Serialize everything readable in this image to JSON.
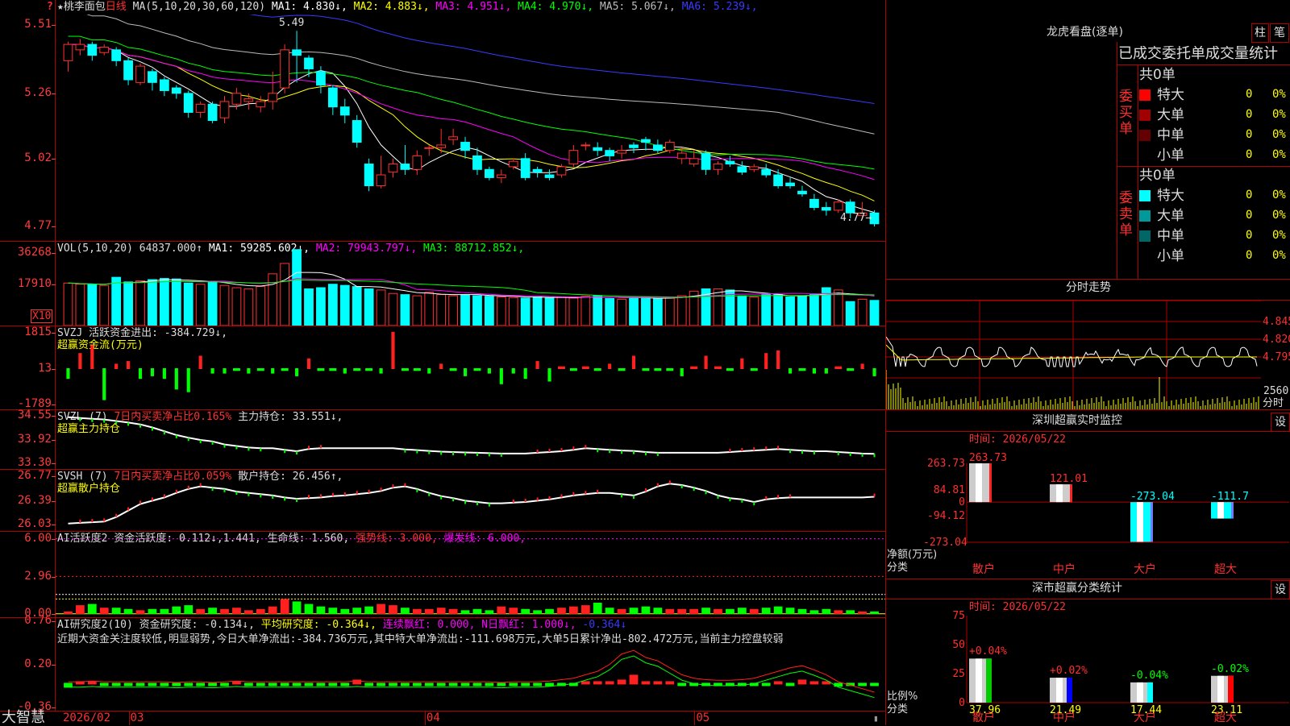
{
  "logo_mark": "?",
  "main": {
    "title": "★桃李面包",
    "period": "日线",
    "ma_params": "MA(5,10,20,30,60,120)",
    "ma": [
      {
        "label": "MA1:",
        "value": "4.830↓",
        "color": "#ffffff"
      },
      {
        "label": "MA2:",
        "value": "4.883↓",
        "color": "#ffff00"
      },
      {
        "label": "MA3:",
        "value": "4.951↓",
        "color": "#ff00ff"
      },
      {
        "label": "MA4:",
        "value": "4.970↓",
        "color": "#00ff00"
      },
      {
        "label": "MA5:",
        "value": "5.067↓",
        "color": "#bbbbbb"
      },
      {
        "label": "MA6:",
        "value": "5.239↓",
        "color": "#3a3aff"
      }
    ],
    "y_ticks": [
      "5.51",
      "5.26",
      "5.02",
      "4.77"
    ],
    "high_label": "5.49",
    "low_label": "4.77",
    "candles": [
      [
        5.38,
        5.44,
        5.34,
        5.45
      ],
      [
        5.42,
        5.44,
        5.4,
        5.46
      ],
      [
        5.44,
        5.4,
        5.38,
        5.45
      ],
      [
        5.41,
        5.43,
        5.4,
        5.44
      ],
      [
        5.42,
        5.38,
        5.36,
        5.43
      ],
      [
        5.38,
        5.31,
        5.29,
        5.39
      ],
      [
        5.3,
        5.36,
        5.29,
        5.37
      ],
      [
        5.34,
        5.3,
        5.27,
        5.35
      ],
      [
        5.31,
        5.27,
        5.25,
        5.32
      ],
      [
        5.28,
        5.26,
        5.24,
        5.29
      ],
      [
        5.26,
        5.19,
        5.17,
        5.27
      ],
      [
        5.19,
        5.22,
        5.17,
        5.23
      ],
      [
        5.22,
        5.16,
        5.15,
        5.23
      ],
      [
        5.17,
        5.23,
        5.15,
        5.25
      ],
      [
        5.22,
        5.26,
        5.2,
        5.28
      ],
      [
        5.23,
        5.24,
        5.2,
        5.26
      ],
      [
        5.21,
        5.23,
        5.19,
        5.25
      ],
      [
        5.23,
        5.26,
        5.2,
        5.34
      ],
      [
        5.28,
        5.42,
        5.26,
        5.44
      ],
      [
        5.42,
        5.4,
        5.3,
        5.49
      ],
      [
        5.39,
        5.35,
        5.32,
        5.4
      ],
      [
        5.34,
        5.29,
        5.26,
        5.36
      ],
      [
        5.28,
        5.21,
        5.18,
        5.29
      ],
      [
        5.21,
        5.18,
        5.15,
        5.24
      ],
      [
        5.16,
        5.08,
        5.06,
        5.18
      ],
      [
        5.0,
        4.92,
        4.9,
        5.02
      ],
      [
        4.92,
        4.96,
        4.91,
        5.03
      ],
      [
        4.97,
        5.0,
        4.95,
        5.02
      ],
      [
        5.0,
        4.98,
        4.96,
        5.07
      ],
      [
        4.98,
        5.03,
        4.96,
        5.05
      ],
      [
        5.06,
        5.06,
        5.03,
        5.07
      ],
      [
        5.06,
        5.07,
        5.04,
        5.13
      ],
      [
        5.09,
        5.1,
        5.07,
        5.13
      ],
      [
        5.08,
        5.05,
        5.02,
        5.1
      ],
      [
        5.03,
        4.98,
        4.96,
        5.06
      ],
      [
        4.98,
        4.95,
        4.94,
        4.99
      ],
      [
        4.95,
        4.96,
        4.93,
        4.98
      ],
      [
        4.99,
        5.01,
        4.98,
        5.02
      ],
      [
        5.02,
        4.95,
        4.94,
        5.04
      ],
      [
        4.98,
        4.97,
        4.95,
        4.99
      ],
      [
        4.96,
        4.95,
        4.94,
        4.98
      ],
      [
        4.96,
        4.99,
        4.95,
        5.0
      ],
      [
        5.0,
        5.05,
        4.99,
        5.07
      ],
      [
        5.07,
        5.07,
        5.05,
        5.08
      ],
      [
        5.06,
        5.05,
        5.03,
        5.08
      ],
      [
        5.05,
        5.03,
        5.01,
        5.06
      ],
      [
        5.04,
        5.05,
        5.02,
        5.07
      ],
      [
        5.07,
        5.06,
        5.04,
        5.08
      ],
      [
        5.09,
        5.08,
        5.05,
        5.1
      ],
      [
        5.07,
        5.05,
        5.04,
        5.09
      ],
      [
        5.05,
        5.08,
        5.04,
        5.09
      ],
      [
        5.02,
        5.04,
        5.0,
        5.06
      ],
      [
        5.0,
        5.02,
        4.99,
        5.05
      ],
      [
        5.04,
        4.98,
        4.96,
        5.05
      ],
      [
        4.98,
        5.0,
        4.96,
        5.01
      ],
      [
        5.01,
        5.0,
        4.99,
        5.03
      ],
      [
        4.99,
        4.97,
        4.96,
        5.01
      ],
      [
        4.98,
        4.99,
        4.97,
        5.0
      ],
      [
        4.98,
        4.96,
        4.95,
        5.0
      ],
      [
        4.96,
        4.92,
        4.91,
        4.98
      ],
      [
        4.93,
        4.92,
        4.91,
        4.95
      ],
      [
        4.9,
        4.89,
        4.88,
        4.92
      ],
      [
        4.87,
        4.84,
        4.83,
        4.89
      ],
      [
        4.84,
        4.83,
        4.81,
        4.86
      ],
      [
        4.83,
        4.86,
        4.82,
        4.87
      ],
      [
        4.86,
        4.82,
        4.8,
        4.87
      ],
      [
        4.81,
        4.82,
        4.8,
        4.86
      ],
      [
        4.82,
        4.78,
        4.77,
        4.83
      ]
    ]
  },
  "vol": {
    "title": "VOL(5,10,20)",
    "value": "64837.000↑",
    "ma": [
      {
        "label": "MA1:",
        "value": "59285.602↓",
        "color": "#ffffff"
      },
      {
        "label": "MA2:",
        "value": "79943.797↓",
        "color": "#ff00ff"
      },
      {
        "label": "MA3:",
        "value": "88712.852↓",
        "color": "#00ff00"
      }
    ],
    "y_ticks": [
      "36268",
      "17910"
    ],
    "unit": "X10",
    "bars": [
      13.5,
      13.0,
      12.8,
      12.5,
      16.0,
      14.0,
      14.5,
      15.0,
      15.5,
      15.3,
      13.5,
      13.0,
      14.0,
      12.5,
      11.5,
      11.0,
      12.0,
      17.5,
      22.0,
      28.0,
      11.0,
      11.5,
      13.0,
      12.5,
      12.0,
      11.0,
      10.5,
      9.0,
      8.5,
      8.0,
      9.5,
      8.5,
      8.0,
      8.5,
      8.0,
      7.8,
      7.5,
      7.2,
      7.0,
      7.5,
      7.2,
      7.5,
      7.0,
      7.8,
      8.0,
      6.8,
      6.5,
      7.0,
      7.5,
      6.8,
      7.0,
      8.0,
      10.0,
      11.0,
      11.0,
      10.5,
      8.0,
      7.5,
      8.5,
      8.5,
      7.5,
      8.0,
      8.5,
      11.5,
      10.5,
      5.5,
      6.5,
      6.0
    ]
  },
  "svzj": {
    "title": "SVZJ",
    "label": "活跃资金进出:",
    "value": "-384.729↓,",
    "subtitle": "超赢资金流(万元)",
    "y_ticks": [
      "1815",
      "13",
      "-1789"
    ],
    "bars": [
      -4,
      6,
      9,
      -12,
      2,
      3,
      -4,
      -3,
      -4,
      -8,
      -9,
      5,
      -2,
      -2,
      -1,
      -2,
      -1,
      -2,
      -1,
      -3,
      4,
      -1,
      -1,
      -2,
      -1,
      -1,
      -2,
      14,
      -1,
      -1,
      -2,
      2,
      -1,
      -3,
      -1,
      -2,
      -6,
      -2,
      -4,
      3,
      -5,
      1,
      -1,
      1,
      -1,
      2,
      -1,
      5,
      -1,
      -1,
      -1,
      -3,
      1,
      5,
      1,
      -1,
      4,
      -1,
      6,
      7,
      -2,
      -1,
      -2,
      -2,
      1,
      -1,
      2,
      -3
    ]
  },
  "svzl": {
    "title": "SVZL (7)",
    "subtitle_red": "7日内买卖净占比0.165%",
    "label": "主力持仓:",
    "value": "33.551↓,",
    "subtitle": "超赢主力持仓",
    "y_ticks": [
      "34.55",
      "33.92",
      "33.30"
    ],
    "line": [
      34.52,
      34.5,
      34.48,
      34.46,
      34.42,
      34.38,
      34.33,
      34.25,
      34.15,
      34.05,
      33.98,
      33.92,
      33.88,
      33.8,
      33.76,
      33.72,
      33.7,
      33.7,
      33.66,
      33.62,
      33.68,
      33.7,
      33.7,
      33.7,
      33.7,
      33.7,
      33.7,
      33.7,
      33.67,
      33.65,
      33.63,
      33.61,
      33.6,
      33.59,
      33.58,
      33.57,
      33.56,
      33.56,
      33.56,
      33.58,
      33.6,
      33.62,
      33.66,
      33.7,
      33.68,
      33.66,
      33.64,
      33.63,
      33.6,
      33.58,
      33.58,
      33.58,
      33.58,
      33.58,
      33.58,
      33.6,
      33.62,
      33.64,
      33.66,
      33.68,
      33.66,
      33.64,
      33.62,
      33.62,
      33.6,
      33.58,
      33.56,
      33.55
    ]
  },
  "svsh": {
    "title": "SVSH (7)",
    "subtitle_red": "7日内买卖净占比0.059%",
    "label": "散户持仓:",
    "value": "26.456↑,",
    "subtitle": "超赢散户持仓",
    "y_ticks": [
      "26.77",
      "26.39",
      "26.03"
    ],
    "line": [
      26.05,
      26.06,
      26.07,
      26.08,
      26.15,
      26.25,
      26.35,
      26.4,
      26.45,
      26.52,
      26.58,
      26.62,
      26.6,
      26.58,
      26.54,
      26.52,
      26.5,
      26.48,
      26.45,
      26.43,
      26.44,
      26.45,
      26.47,
      26.48,
      26.5,
      26.52,
      26.55,
      26.6,
      26.62,
      26.58,
      26.52,
      26.47,
      26.44,
      26.4,
      26.38,
      26.36,
      26.36,
      26.37,
      26.38,
      26.4,
      26.42,
      26.45,
      26.48,
      26.5,
      26.52,
      26.52,
      26.5,
      26.48,
      26.54,
      26.62,
      26.66,
      26.64,
      26.6,
      26.55,
      26.48,
      26.44,
      26.42,
      26.38,
      26.42,
      26.44,
      26.45,
      26.45,
      26.45,
      26.45,
      26.45,
      26.45,
      26.45,
      26.46
    ]
  },
  "ai1": {
    "title": "AI活跃度2",
    "label": "资金活跃度:",
    "v1": "0.112↓,",
    "v2": "1.441,",
    "life_label": "生命线:",
    "life_value": "1.560,",
    "strong_label": "强势线:",
    "strong_value": "3.000,",
    "burst_label": "爆发线:",
    "burst_value": "6.000,",
    "y_ticks": [
      "6.00",
      "2.96",
      "0.00"
    ],
    "bars": [
      0.2,
      0.7,
      0.8,
      0.5,
      0.5,
      0.4,
      0.3,
      0.4,
      0.4,
      0.6,
      0.7,
      0.4,
      0.5,
      0.4,
      0.5,
      0.3,
      0.4,
      0.6,
      1.2,
      1.0,
      0.8,
      0.6,
      0.5,
      0.4,
      0.5,
      0.6,
      0.8,
      0.7,
      0.5,
      0.4,
      0.4,
      0.5,
      0.4,
      0.3,
      0.4,
      0.3,
      0.6,
      0.5,
      0.4,
      0.3,
      0.4,
      0.5,
      0.6,
      0.7,
      0.9,
      0.5,
      0.4,
      0.5,
      0.6,
      0.5,
      0.4,
      0.4,
      0.4,
      0.5,
      0.4,
      0.4,
      0.5,
      0.4,
      0.5,
      0.6,
      0.5,
      0.4,
      0.3,
      0.4,
      0.3,
      0.3,
      0.2,
      0.2
    ]
  },
  "ai2": {
    "title": "AI研究度2(10)",
    "label": "资金研究度:",
    "value": "-0.134↓,",
    "avg_label": "平均研究度:",
    "avg_value": "-0.364↓,",
    "red_label": "连续飘红:",
    "red_value": "0.000,",
    "n_label": "N日飘红:",
    "n_value": "1.000↓,",
    "last_value": "-0.364↓",
    "comment": "近期大资金关注度较低,明显弱势,今日大单净流出:-384.736万元,其中特大单净流出:-111.698万元,大单5日累计净出-802.472万元,当前主力控盘较弱",
    "y_ticks": [
      "0.76",
      "0.20",
      "-0.36"
    ],
    "bars": [
      -0.1,
      0.02,
      0.03,
      -0.06,
      -0.05,
      -0.04,
      -0.05,
      -0.05,
      -0.04,
      -0.05,
      -0.06,
      -0.04,
      -0.05,
      -0.05,
      0.03,
      -0.03,
      -0.03,
      -0.05,
      -0.06,
      -0.05,
      -0.06,
      -0.04,
      -0.04,
      -0.04,
      0.1,
      -0.03,
      -0.04,
      -0.03,
      -0.04,
      -0.05,
      -0.06,
      -0.05,
      -0.04,
      -0.05,
      -0.06,
      -0.05,
      -0.06,
      -0.05,
      -0.06,
      -0.05,
      -0.04,
      -0.05,
      -0.05,
      0.02,
      0.03,
      0.03,
      0.1,
      0.2,
      0.05,
      0.03,
      0.02,
      -0.03,
      -0.03,
      -0.03,
      -0.03,
      -0.03,
      -0.03,
      -0.05,
      -0.04,
      0.03,
      -0.03,
      0.1,
      0.05,
      0.05,
      -0.08,
      -0.05,
      -0.05,
      -0.05
    ],
    "line": [
      -0.05,
      -0.05,
      -0.04,
      -0.05,
      -0.05,
      -0.05,
      -0.05,
      -0.05,
      -0.05,
      -0.06,
      -0.05,
      -0.05,
      -0.06,
      -0.05,
      -0.04,
      -0.05,
      -0.05,
      -0.05,
      -0.05,
      -0.05,
      -0.05,
      -0.05,
      -0.05,
      -0.05,
      -0.04,
      -0.05,
      -0.05,
      -0.05,
      -0.05,
      -0.05,
      -0.05,
      -0.05,
      -0.05,
      -0.05,
      -0.05,
      -0.05,
      -0.06,
      -0.05,
      -0.05,
      -0.05,
      -0.04,
      -0.02,
      0.0,
      0.05,
      0.1,
      0.2,
      0.35,
      0.4,
      0.3,
      0.25,
      0.15,
      0.05,
      0.0,
      -0.02,
      -0.03,
      -0.03,
      -0.02,
      0.0,
      0.05,
      0.1,
      0.15,
      0.18,
      0.12,
      0.05,
      -0.05,
      -0.1,
      -0.15,
      -0.2
    ]
  },
  "x_axis": {
    "start": "2026/02",
    "ticks": [
      {
        "label": "03",
        "pos": 0.088
      },
      {
        "label": "04",
        "pos": 0.445
      },
      {
        "label": "05",
        "pos": 0.77
      }
    ]
  },
  "bottom_left": "大智慧",
  "right": {
    "dragon": {
      "title": "龙虎看盘(逐单)",
      "tab1": "柱",
      "tab2": "笔",
      "table_title": "已成交委托单成交量统计",
      "buy_side": "委买单",
      "sell_side": "委卖单",
      "buy_total": "共0单",
      "sell_total": "共0单",
      "buy_rows": [
        {
          "name": "特大",
          "value": "0",
          "pct": "0%",
          "color": "#ff0000"
        },
        {
          "name": "大单",
          "value": "0",
          "pct": "0%",
          "color": "#a00000"
        },
        {
          "name": "中单",
          "value": "0",
          "pct": "0%",
          "color": "#660000"
        },
        {
          "name": "小单",
          "value": "0",
          "pct": "0%",
          "color": "#000000"
        }
      ],
      "sell_rows": [
        {
          "name": "特大",
          "value": "0",
          "pct": "0%",
          "color": "#00ffff"
        },
        {
          "name": "大单",
          "value": "0",
          "pct": "0%",
          "color": "#009999"
        },
        {
          "name": "中单",
          "value": "0",
          "pct": "0%",
          "color": "#006666"
        },
        {
          "name": "小单",
          "value": "0",
          "pct": "0%",
          "color": "#000000"
        }
      ]
    },
    "intraday": {
      "title": "分时走势",
      "y_ticks": [
        "4.845",
        "4.820",
        "4.795"
      ],
      "vol_tick": "2560",
      "vol_unit": "分时"
    },
    "monitor": {
      "title": "深圳超赢实时监控",
      "settings": "设",
      "time": "时间: 2026/05/22",
      "unit_label": "净额(万元)",
      "cat_label": "分类",
      "y_ticks": [
        "263.73",
        "84.81",
        "0",
        "-94.12",
        "-273.04"
      ],
      "bars": [
        {
          "name": "散户",
          "value": 263.73,
          "label": "263.73"
        },
        {
          "name": "中户",
          "value": 121.01,
          "label": "121.01"
        },
        {
          "name": "大户",
          "value": -273.04,
          "label": "-273.04"
        },
        {
          "name": "超大",
          "value": -111.7,
          "label": "-111.7"
        }
      ],
      "ylim": [
        -273.04,
        263.73
      ]
    },
    "stats": {
      "title": "深市超赢分类统计",
      "settings": "设",
      "time": "时间: 2026/05/22",
      "ratio_label": "比例%",
      "cat_label": "分类",
      "y_ticks": [
        "75",
        "50",
        "25",
        "0"
      ],
      "bars": [
        {
          "name": "散户",
          "value": 37.96,
          "label": "37.96",
          "change": "+0.04%",
          "color": "#ffffff",
          "accent": "#00cc00"
        },
        {
          "name": "中户",
          "value": 21.49,
          "label": "21.49",
          "change": "+0.02%",
          "color": "#ffffff",
          "accent": "#0000ff"
        },
        {
          "name": "大户",
          "value": 17.44,
          "label": "17.44",
          "change": "-0.04%",
          "color": "#ffffff",
          "accent": "#00ffff"
        },
        {
          "name": "超大",
          "value": 23.11,
          "label": "23.11",
          "change": "-0.02%",
          "color": "#ffffff",
          "accent": "#ff0000"
        }
      ],
      "ylim": [
        0,
        75
      ]
    }
  },
  "chart_data": [
    {
      "type": "candlestick",
      "title": "★桃李面包",
      "series": [
        {
          "name": "MA1",
          "color": "#ffffff"
        },
        {
          "name": "MA2",
          "color": "#ffff00"
        },
        {
          "name": "MA3",
          "color": "#ff00ff"
        },
        {
          "name": "MA4",
          "color": "#00ff00"
        },
        {
          "name": "MA5",
          "color": "#bbbbbb"
        },
        {
          "name": "MA6",
          "color": "#3a3aff"
        }
      ],
      "ylim": [
        4.72,
        5.55
      ],
      "y_ticks": [
        "5.51",
        "5.26",
        "5.02",
        "4.77"
      ],
      "x_ticks": [
        "2026/02",
        "03",
        "04",
        "05"
      ]
    },
    {
      "type": "bar",
      "title": "深圳超赢实时监控",
      "categories": [
        "散户",
        "中户",
        "大户",
        "超大"
      ],
      "values": [
        263.73,
        121.01,
        -273.04,
        -111.7
      ],
      "ylabel": "净额(万元)",
      "xlabel": "分类",
      "ylim": [
        -273.04,
        263.73
      ]
    },
    {
      "type": "bar",
      "title": "深市超赢分类统计",
      "categories": [
        "散户",
        "中户",
        "大户",
        "超大"
      ],
      "values": [
        37.96,
        21.49,
        17.44,
        23.11
      ],
      "ylabel": "比例%",
      "xlabel": "分类",
      "ylim": [
        0,
        75
      ]
    }
  ]
}
